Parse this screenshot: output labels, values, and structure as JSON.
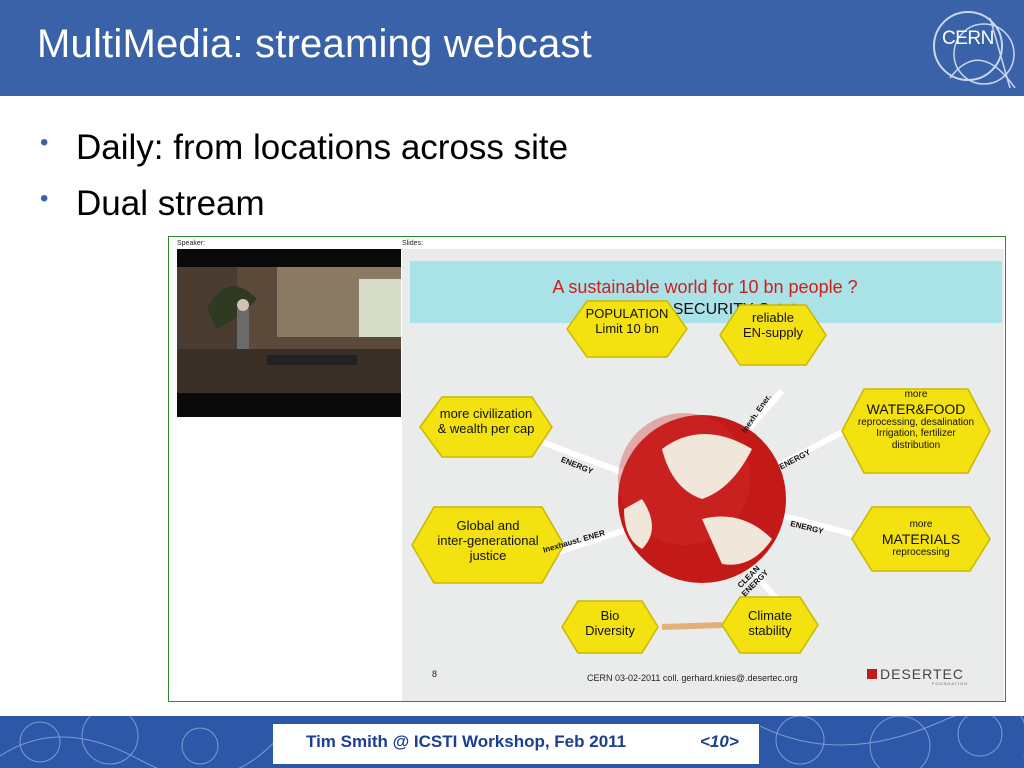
{
  "slide": {
    "title": "MultiMedia: streaming webcast",
    "logo_text": "CERN",
    "bullets": [
      "Daily: from locations across site",
      "Dual stream"
    ]
  },
  "webcast": {
    "speaker_label": "Speaker:",
    "slides_label": "Slides:",
    "embedded_slide": {
      "heading": "A sustainable world for 10 bn people ?",
      "subheading": "HUMAN SECURITY Octet:",
      "hexagons": {
        "population": [
          "POPULATION",
          "Limit 10 bn"
        ],
        "energy_supply": [
          "reliable",
          "EN-supply"
        ],
        "water_food": [
          "more",
          "WATER&FOOD",
          "reprocessing, desalination",
          "Irrigation, fertilizer",
          "distribution"
        ],
        "civilization": [
          "more civilization",
          "& wealth per cap"
        ],
        "materials": [
          "more",
          "MATERIALS",
          "reprocessing"
        ],
        "justice": [
          "Global and",
          "inter-generational",
          "justice"
        ],
        "biodiversity": [
          "Bio",
          "Diversity"
        ],
        "climate": [
          "Climate",
          "stability"
        ]
      },
      "arrow_labels": {
        "energy_left": "ENERGY",
        "inexh_top": "Inexh. Ener.",
        "energy_right_top": "ENERGY",
        "energy_right": "ENERGY",
        "inexhaust": "Inexhaust. ENER",
        "clean_energy": "CLEAN ENERGY"
      },
      "page_number": "8",
      "footer": "CERN 03-02-2011 coll. gerhard.knies@.desertec.org",
      "brand": "DESERTEC",
      "brand_sub": "FOUNDATION"
    }
  },
  "footer": {
    "text": "Tim Smith @ ICSTI Workshop, Feb 2011",
    "page": "<10>"
  },
  "colors": {
    "header_bg": "#3a62a8",
    "accent": "#3a62a8",
    "hex_fill": "#f3e20f",
    "globe_red": "#c41a17",
    "footer_text": "#1a3f92"
  }
}
